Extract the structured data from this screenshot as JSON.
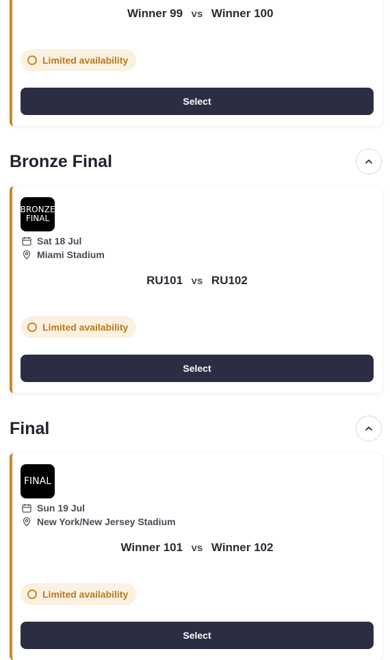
{
  "match_prev": {
    "home": "Winner 99",
    "vs": "vs",
    "away": "Winner 100",
    "availability": "Limited availability",
    "select_label": "Select"
  },
  "sections": [
    {
      "title": "Bronze Final",
      "match": {
        "badge": "BRONZE\nFINAL",
        "date": "Sat 18 Jul",
        "venue": "Miami Stadium",
        "home": "RU101",
        "vs": "vs",
        "away": "RU102",
        "availability": "Limited availability",
        "select_label": "Select"
      }
    },
    {
      "title": "Final",
      "match": {
        "badge": "FINAL",
        "date": "Sun 19 Jul",
        "venue": "New York/New Jersey Stadium",
        "home": "Winner 101",
        "vs": "vs",
        "away": "Winner 102",
        "availability": "Limited availability",
        "select_label": "Select"
      }
    }
  ],
  "icons": {
    "calendar": "calendar-icon",
    "location": "location-pin-icon",
    "chevron": "chevron-up-icon",
    "availability": "circle-icon"
  },
  "colors": {
    "accent": "#c8892a",
    "button": "#2b2d42",
    "availability_bg": "#fbf1e1"
  }
}
